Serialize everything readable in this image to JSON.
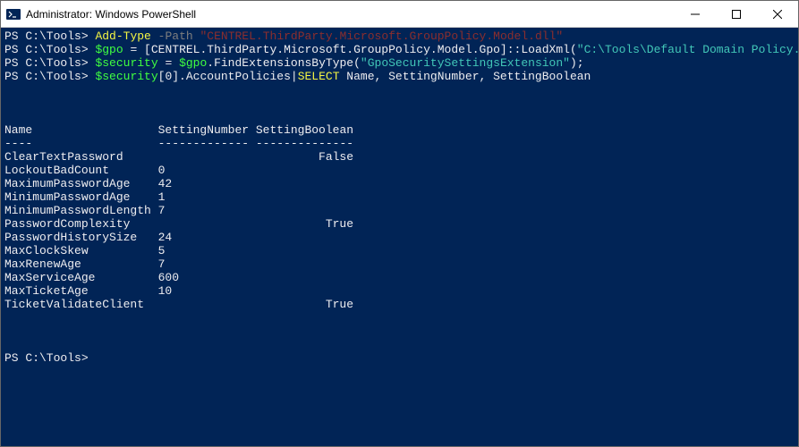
{
  "titlebar": {
    "title": "Administrator: Windows PowerShell"
  },
  "prompt": "PS C:\\Tools>",
  "lines": {
    "l1": {
      "cmd": "Add-Type",
      "param": "-Path",
      "arg": "\"CENTREL.ThirdParty.Microsoft.GroupPolicy.Model.dll\""
    },
    "l2": {
      "var": "$gpo",
      "eq": " = [CENTREL.ThirdParty.Microsoft.GroupPolicy.Model.Gpo]::",
      "method": "LoadXml",
      "paren1": "(",
      "arg": "\"C:\\Tools\\Default Domain Policy.xml\"",
      "paren2": ");"
    },
    "l3": {
      "var": "$security",
      "eq": " = ",
      "var2": "$gpo",
      "method": ".FindExtensionsByType(",
      "arg": "\"GpoSecuritySettingsExtension\"",
      "close": ");"
    },
    "l4": {
      "var": "$security",
      "idx": "[0].AccountPolicies|",
      "select": "SELECT",
      "cols": " Name, SettingNumber, SettingBoolean"
    }
  },
  "headers": {
    "name": "Name",
    "num": "SettingNumber",
    "bool": "SettingBoolean"
  },
  "dashes": {
    "name": "----",
    "num": "-------------",
    "bool": "--------------"
  },
  "rows": [
    {
      "name": "ClearTextPassword",
      "num": "",
      "bool": "False"
    },
    {
      "name": "LockoutBadCount",
      "num": "0",
      "bool": ""
    },
    {
      "name": "MaximumPasswordAge",
      "num": "42",
      "bool": ""
    },
    {
      "name": "MinimumPasswordAge",
      "num": "1",
      "bool": ""
    },
    {
      "name": "MinimumPasswordLength",
      "num": "7",
      "bool": ""
    },
    {
      "name": "PasswordComplexity",
      "num": "",
      "bool": "True"
    },
    {
      "name": "PasswordHistorySize",
      "num": "24",
      "bool": ""
    },
    {
      "name": "MaxClockSkew",
      "num": "5",
      "bool": ""
    },
    {
      "name": "MaxRenewAge",
      "num": "7",
      "bool": ""
    },
    {
      "name": "MaxServiceAge",
      "num": "600",
      "bool": ""
    },
    {
      "name": "MaxTicketAge",
      "num": "10",
      "bool": ""
    },
    {
      "name": "TicketValidateClient",
      "num": "",
      "bool": "True"
    }
  ],
  "chart_data": {
    "type": "table",
    "title": "AccountPolicies",
    "columns": [
      "Name",
      "SettingNumber",
      "SettingBoolean"
    ],
    "rows": [
      [
        "ClearTextPassword",
        null,
        false
      ],
      [
        "LockoutBadCount",
        0,
        null
      ],
      [
        "MaximumPasswordAge",
        42,
        null
      ],
      [
        "MinimumPasswordAge",
        1,
        null
      ],
      [
        "MinimumPasswordLength",
        7,
        null
      ],
      [
        "PasswordComplexity",
        null,
        true
      ],
      [
        "PasswordHistorySize",
        24,
        null
      ],
      [
        "MaxClockSkew",
        5,
        null
      ],
      [
        "MaxRenewAge",
        7,
        null
      ],
      [
        "MaxServiceAge",
        600,
        null
      ],
      [
        "MaxTicketAge",
        10,
        null
      ],
      [
        "TicketValidateClient",
        null,
        true
      ]
    ]
  }
}
